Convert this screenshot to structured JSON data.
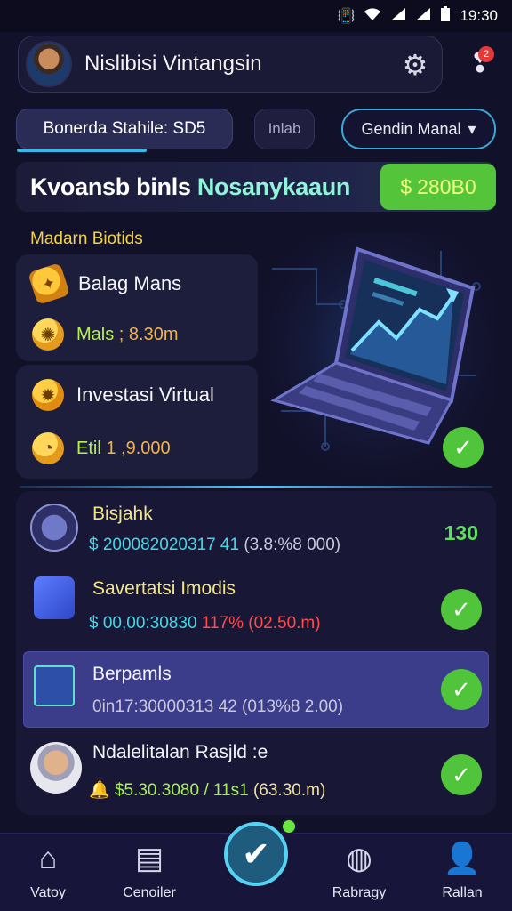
{
  "status_bar": {
    "time": "19:30"
  },
  "header": {
    "username": "Nislibisi Vintangsin",
    "notification_count": "2"
  },
  "balance_pill": {
    "label": "Bonerda Stahile: SD5"
  },
  "tab_pill": {
    "label": "Inlab"
  },
  "select_pill": {
    "label": "Gendin Manal"
  },
  "promo": {
    "title": "Kvoansb binls",
    "title_highlight": "Nosanykaaun",
    "amount": "280B0"
  },
  "section_label": "Madarn Biotids",
  "card_a": {
    "title": "Balag Mans",
    "value_label": "Mals",
    "value": "; 8.30m"
  },
  "card_b": {
    "title": "Investasi Virtual",
    "value_label": "Etil",
    "value": "1 ,9.000"
  },
  "list": {
    "items": [
      {
        "title": "Bisjahk",
        "sub_a": "$ 200082020317 41",
        "sub_b": "(3.8:%8 000)",
        "right": "130"
      },
      {
        "title": "Savertatsi Imodis",
        "sub_a": "$ 00,00:30830",
        "sub_b": "117%",
        "sub_c": "(02.50.m)"
      },
      {
        "title": "Berpamls",
        "sub_a": "0in17:30000313 42",
        "sub_b": "(013%8 2.00)"
      },
      {
        "title": "Ndalelitalan Rasjld :e",
        "sub_a": "$5.30.3080",
        "sub_b": "/ 11s1",
        "sub_c": "(63.30.m)"
      }
    ]
  },
  "bottom_nav": {
    "items": [
      {
        "label": "Vatoy"
      },
      {
        "label": "Cenoiler"
      },
      {
        "label": "Rabragy"
      },
      {
        "label": "Rallan"
      }
    ]
  },
  "colors": {
    "accent_cyan": "#56d3f2",
    "accent_green": "#50c43a",
    "highlight": "#3b3c8a"
  }
}
